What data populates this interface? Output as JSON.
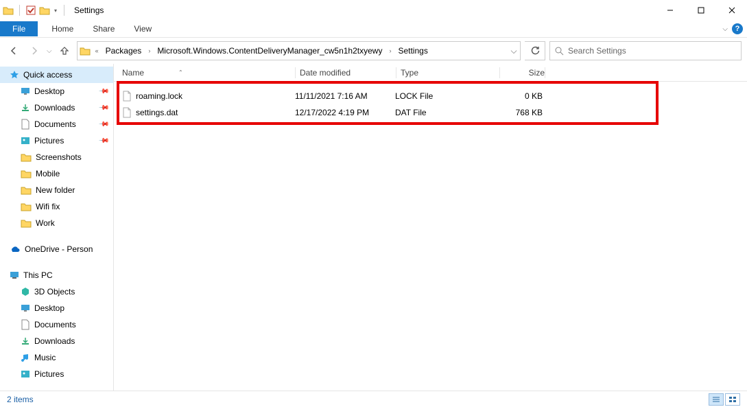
{
  "window": {
    "title": "Settings"
  },
  "ribbon": {
    "file": "File",
    "tabs": [
      "Home",
      "Share",
      "View"
    ]
  },
  "breadcrumb": {
    "overflow": "«",
    "segments": [
      "Packages",
      "Microsoft.Windows.ContentDeliveryManager_cw5n1h2txyewy",
      "Settings"
    ]
  },
  "search": {
    "placeholder": "Search Settings"
  },
  "sidebar": {
    "quick_access": "Quick access",
    "qa_items": [
      "Desktop",
      "Downloads",
      "Documents",
      "Pictures",
      "Screenshots",
      "Mobile",
      "New folder",
      "Wifi fix",
      "Work"
    ],
    "onedrive": "OneDrive - Person",
    "this_pc": "This PC",
    "pc_items": [
      "3D Objects",
      "Desktop",
      "Documents",
      "Downloads",
      "Music",
      "Pictures"
    ]
  },
  "columns": {
    "name": "Name",
    "date": "Date modified",
    "type": "Type",
    "size": "Size"
  },
  "files": [
    {
      "name": "roaming.lock",
      "date": "11/11/2021 7:16 AM",
      "type": "LOCK File",
      "size": "0 KB"
    },
    {
      "name": "settings.dat",
      "date": "12/17/2022 4:19 PM",
      "type": "DAT File",
      "size": "768 KB"
    }
  ],
  "status": {
    "text": "2 items"
  }
}
